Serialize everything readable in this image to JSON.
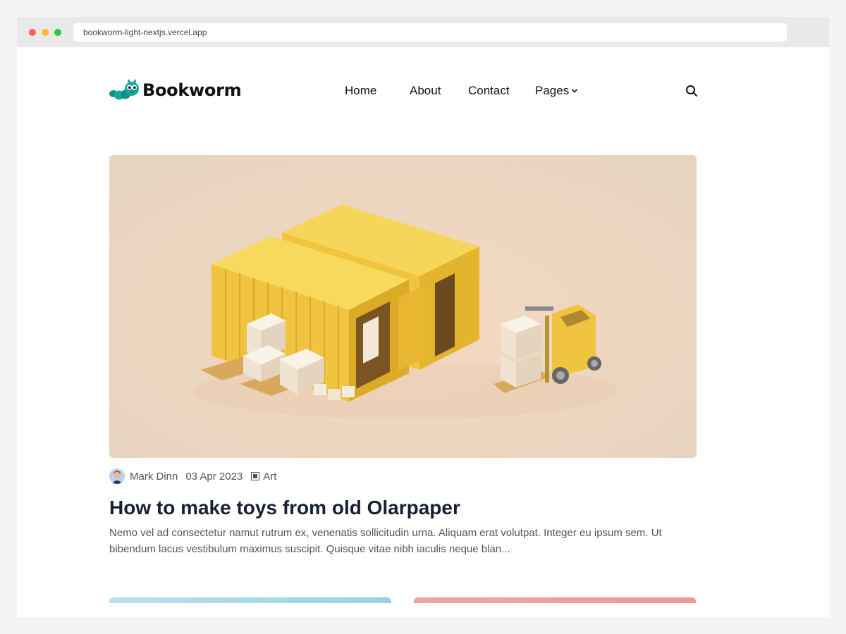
{
  "browser": {
    "url": "bookworm-light-nextjs.vercel.app"
  },
  "header": {
    "logo_text": "Bookworm",
    "nav": [
      {
        "label": "Home"
      },
      {
        "label": "About"
      },
      {
        "label": "Contact"
      },
      {
        "label": "Pages"
      }
    ]
  },
  "featured_post": {
    "author": "Mark Dinn",
    "date": "03 Apr 2023",
    "category": "Art",
    "title": "How to make toys from old Olarpaper",
    "excerpt": "Nemo vel ad consectetur namut rutrum ex, venenatis sollicitudin urna. Aliquam erat volutpat. Integer eu ipsum sem. Ut bibendum lacus vestibulum maximus suscipit. Quisque vitae nibh iaculis neque blan..."
  },
  "icons": {
    "logo": "bookworm-caterpillar-icon",
    "pages_dropdown": "chevron-down-icon",
    "search": "search-icon",
    "category": "category-square-icon"
  },
  "colors": {
    "brand_teal": "#14a89a",
    "heading": "#172033",
    "body_text": "#555555",
    "hero_bg": "#ead5bf",
    "container_yellow": "#f3c83c"
  }
}
